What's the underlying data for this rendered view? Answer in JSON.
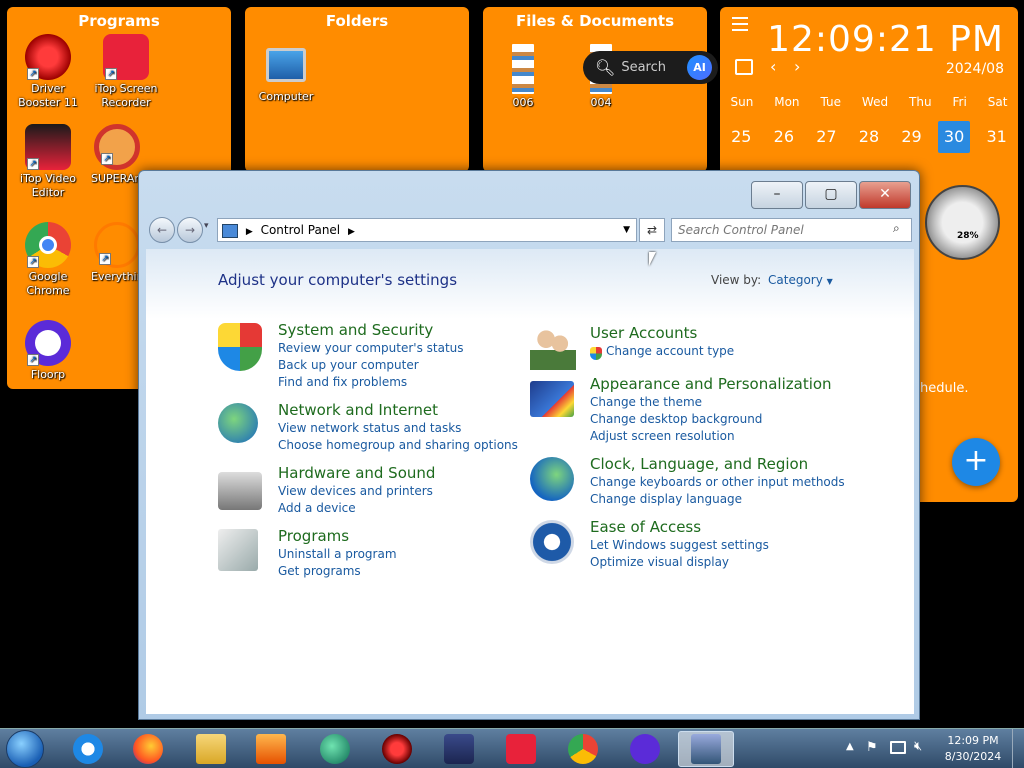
{
  "fences": {
    "programs": {
      "title": "Programs",
      "icons": [
        {
          "label": "Driver Booster 11",
          "color": "#d91a1a"
        },
        {
          "label": "iTop Screen Recorder",
          "color": "#e8223a"
        },
        {
          "label": "iTop Video Editor",
          "color": "#e8223a"
        },
        {
          "label": "SUPERAntiSpyware Free",
          "color": "#c0392b"
        },
        {
          "label": "Google Chrome",
          "color": "#34a853"
        },
        {
          "label": "Everything",
          "color": "#ff7a00"
        },
        {
          "label": "Floorp",
          "color": "#5b2bd8"
        }
      ]
    },
    "folders": {
      "title": "Folders",
      "icons": [
        {
          "label": "Computer"
        }
      ]
    },
    "files": {
      "title": "Files & Documents",
      "icons": [
        {
          "label": "006"
        },
        {
          "label": "004"
        }
      ]
    }
  },
  "searchpill": {
    "label": "Search",
    "ai": "AI"
  },
  "clock": {
    "time": "12:09:21 PM",
    "month": "2024/08",
    "days": [
      "Sun",
      "Mon",
      "Tue",
      "Wed",
      "Thu",
      "Fri",
      "Sat"
    ],
    "dates": [
      "25",
      "26",
      "27",
      "28",
      "29",
      "30",
      "31"
    ],
    "today_index": 5,
    "schedule_text": "hedule.",
    "add_symbol": "+",
    "gauge_percent": "28%"
  },
  "window": {
    "address": "Control Panel",
    "search_placeholder": "Search Control Panel",
    "heading": "Adjust your computer's settings",
    "viewby_label": "View by:",
    "viewby_value": "Category",
    "categories_left": [
      {
        "title": "System and Security",
        "links": [
          "Review your computer's status",
          "Back up your computer",
          "Find and fix problems"
        ]
      },
      {
        "title": "Network and Internet",
        "links": [
          "View network status and tasks",
          "Choose homegroup and sharing options"
        ]
      },
      {
        "title": "Hardware and Sound",
        "links": [
          "View devices and printers",
          "Add a device"
        ]
      },
      {
        "title": "Programs",
        "links": [
          "Uninstall a program",
          "Get programs"
        ]
      }
    ],
    "categories_right": [
      {
        "title": "User Accounts",
        "links": [
          "Change account type"
        ]
      },
      {
        "title": "Appearance and Personalization",
        "links": [
          "Change the theme",
          "Change desktop background",
          "Adjust screen resolution"
        ]
      },
      {
        "title": "Clock, Language, and Region",
        "links": [
          "Change keyboards or other input methods",
          "Change display language"
        ]
      },
      {
        "title": "Ease of Access",
        "links": [
          "Let Windows suggest settings",
          "Optimize visual display"
        ]
      }
    ]
  },
  "taskbar": {
    "time": "12:09 PM",
    "date": "8/30/2024"
  }
}
